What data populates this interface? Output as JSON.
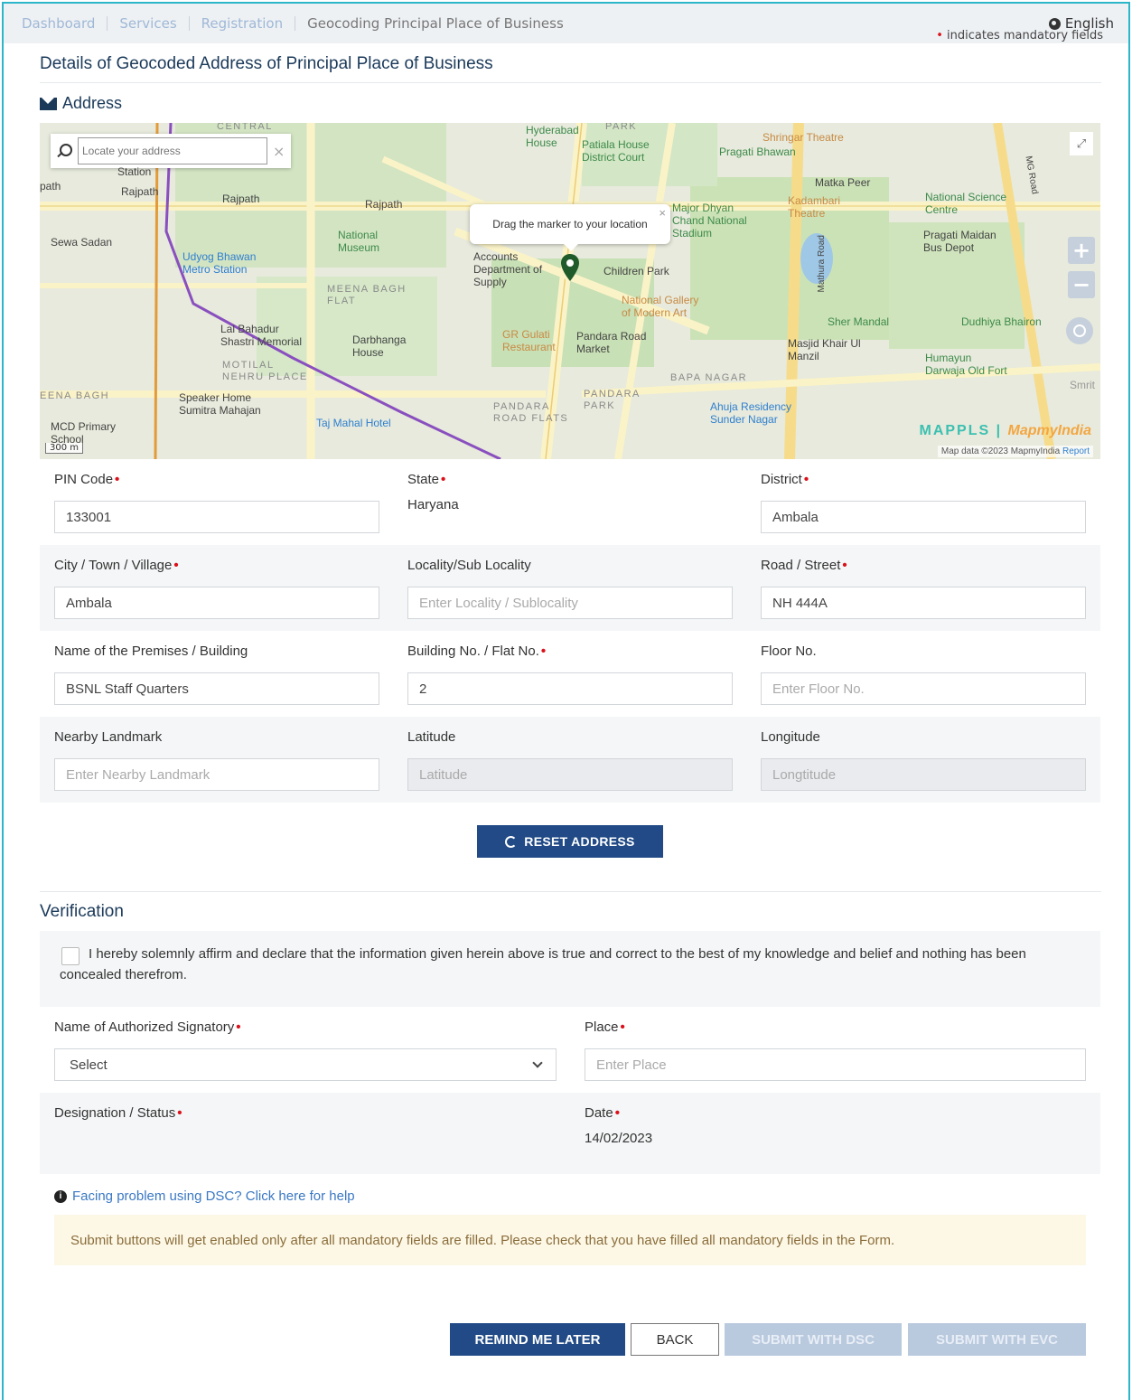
{
  "breadcrumb": [
    "Dashboard",
    "Services",
    "Registration",
    "Geocoding Principal Place of Business"
  ],
  "language": "English",
  "mandatory_note": "indicates mandatory fields",
  "section_title": "Details of Geocoded Address of Principal Place of Business",
  "address_heading": "Address",
  "map": {
    "search_placeholder": "Locate your address",
    "tooltip": "Drag the marker to your location",
    "brand": "MAPPLS",
    "brand2": "MapmyIndia",
    "credit": "Map data ©2023 MapmyIndia",
    "report": "Report",
    "scale": "300 m",
    "labels": {
      "hyderabad_house": "Hyderabad\nHouse",
      "patiala_house": "Patiala House\nDistrict Court",
      "shringar": "Shringar Theatre",
      "pragati_bhawan": "Pragati Bhawan",
      "matka_peer": "Matka Peer",
      "kadambari": "Kadambari\nTheatre",
      "nsc": "National Science\nCentre",
      "pragati_maidan": "Pragati Maidan\nBus Depot",
      "dhyan": "Major Dhyan\nChand National\nStadium",
      "rajpath1": "Rajpath",
      "rajpath2": "Rajpath",
      "rajpath3": "Rajpath",
      "sewa_sadan": "Sewa Sadan",
      "udyog": "Udyog Bhawan\nMetro Station",
      "museum": "National\nMuseum",
      "meena_bagh": "MEENA BAGH\nFLAT",
      "accounts": "Accounts\nDepartment of\nSupply",
      "children_park": "Children Park",
      "ngma": "National Gallery\nof Modern Art",
      "lal_bahadur": "Lal Bahadur\nShastri Memorial",
      "darbhanga": "Darbhanga\nHouse",
      "gr_gulati": "GR Gulati\nRestaurant",
      "pandara_market": "Pandara Road\nMarket",
      "sher_mandal": "Sher Mandal",
      "dudhiya": "Dudhiya Bhairon",
      "masjid": "Masjid Khair Ul\nManzil",
      "humayun": "Humayun\nDarwaja Old Fort",
      "motilal": "MOTILAL\nNEHRU PLACE",
      "bapa_nagar": "BAPA NAGAR",
      "eena_bagh": "EENA BAGH",
      "speaker": "Speaker Home\nSumitra Mahajan",
      "pandara_flats": "PANDARA\nROAD FLATS",
      "pandara_park": "PANDARA\nPARK",
      "ahuja": "Ahuja Residency\nSunder Nagar",
      "mcd": "MCD Primary\nSchool",
      "taj": "Taj Mahal Hotel",
      "mathura": "Mathura Road",
      "mg_road": "MG Road",
      "central": "CENTRAL",
      "station": "Station",
      "path": "path",
      "park": "PARK",
      "smrit": "Smrit"
    }
  },
  "fields": {
    "pin": {
      "label": "PIN Code",
      "value": "133001"
    },
    "state": {
      "label": "State",
      "value": "Haryana"
    },
    "district": {
      "label": "District",
      "value": "Ambala"
    },
    "city": {
      "label": "City / Town / Village",
      "value": "Ambala"
    },
    "locality": {
      "label": "Locality/Sub Locality",
      "placeholder": "Enter Locality / Sublocality"
    },
    "road": {
      "label": "Road / Street",
      "value": "NH 444A"
    },
    "premises": {
      "label": "Name of the Premises / Building",
      "value": "BSNL Staff Quarters"
    },
    "building_no": {
      "label": "Building No. / Flat No.",
      "value": "2"
    },
    "floor": {
      "label": "Floor No.",
      "placeholder": "Enter Floor No."
    },
    "landmark": {
      "label": "Nearby Landmark",
      "placeholder": "Enter Nearby Landmark"
    },
    "latitude": {
      "label": "Latitude",
      "placeholder": "Latitude"
    },
    "longitude": {
      "label": "Longitude",
      "placeholder": "Longtitude"
    }
  },
  "reset_label": "RESET ADDRESS",
  "verification": {
    "title": "Verification",
    "declaration": "I hereby solemnly affirm and declare that the information given herein above is true and correct to the best of my knowledge and belief and nothing has been concealed therefrom.",
    "signatory_label": "Name of Authorized Signatory",
    "signatory_value": "Select",
    "place_label": "Place",
    "place_placeholder": "Enter Place",
    "designation_label": "Designation / Status",
    "date_label": "Date",
    "date_value": "14/02/2023"
  },
  "help_link": "Facing problem using DSC? Click here for help",
  "alert": "Submit buttons will get enabled only after all mandatory fields are filled. Please check that you have filled all mandatory fields in the Form.",
  "buttons": {
    "remind": "REMIND ME LATER",
    "back": "BACK",
    "dsc": "SUBMIT WITH DSC",
    "evc": "SUBMIT WITH EVC"
  },
  "colors": {
    "primary": "#214a86",
    "disabled": "#b9c9de",
    "mandatory": "#d9121b",
    "link": "#3a78c3",
    "frame": "#2bb6c9"
  }
}
